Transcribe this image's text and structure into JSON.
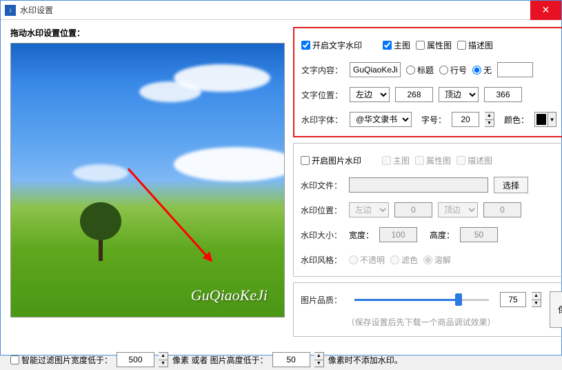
{
  "title": "水印设置",
  "drag_label": "拖动水印设置位置：",
  "watermark_preview": "GuQiaoKeJi",
  "text_wm": {
    "enable": "开启文字水印",
    "main_img": "主图",
    "attr_img": "属性图",
    "desc_img": "描述图",
    "content_label": "文字内容：",
    "content_value": "GuQiaoKeJi",
    "opt_title": "标题",
    "opt_line": "行号",
    "opt_none": "无",
    "pos_label": "文字位置：",
    "pos_x_sel": "左边",
    "pos_x": "268",
    "pos_y_sel": "顶边",
    "pos_y": "366",
    "font_label": "水印字体：",
    "font_value": "@华文隶书",
    "size_label": "字号：",
    "size_value": "20",
    "color_label": "颜色："
  },
  "img_wm": {
    "enable": "开启图片水印",
    "main_img": "主图",
    "attr_img": "属性图",
    "desc_img": "描述图",
    "file_label": "水印文件：",
    "file_value": "",
    "browse": "选择",
    "pos_label": "水印位置：",
    "pos_x_sel": "左边",
    "pos_x": "0",
    "pos_y_sel": "顶边",
    "pos_y": "0",
    "size_label": "水印大小：",
    "w_label": "宽度：",
    "w_value": "100",
    "h_label": "高度：",
    "h_value": "50",
    "style_label": "水印风格：",
    "opt_opaque": "不透明",
    "opt_filter": "滤色",
    "opt_dissolve": "溶解"
  },
  "quality": {
    "label": "图片品质：",
    "value": "75",
    "hint": "（保存设置后先下载一个商品调试效果）",
    "save": "保存设置"
  },
  "bottom": {
    "filter_label": "智能过滤图片宽度低于：",
    "width_value": "500",
    "mid": "像素 或者 图片高度低于：",
    "height_value": "50",
    "tail": "像素时不添加水印。"
  }
}
